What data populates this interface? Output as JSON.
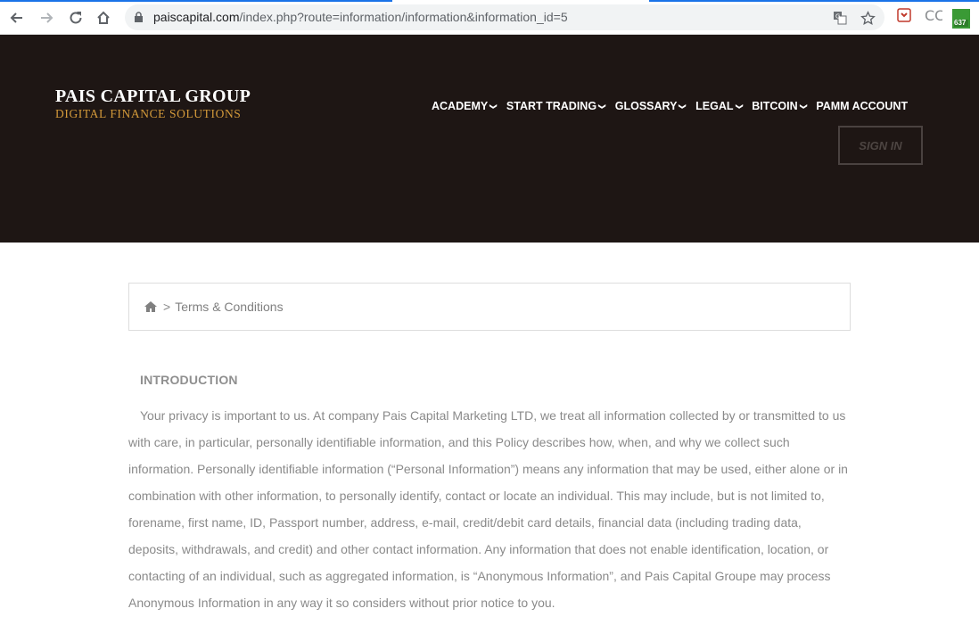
{
  "browser": {
    "url_host": "paiscapital.com",
    "url_path": "/index.php?route=information/information&information_id=5",
    "extension_badge": "637"
  },
  "site": {
    "logo_line1": "PAIS CAPITAL GROUP",
    "logo_line2": "DIGITAL FINANCE SOLUTIONS",
    "menu": [
      {
        "label": "ACADEMY",
        "has_dropdown": true
      },
      {
        "label": "START TRADING",
        "has_dropdown": true
      },
      {
        "label": "GLOSSARY",
        "has_dropdown": true
      },
      {
        "label": "LEGAL",
        "has_dropdown": true
      },
      {
        "label": "BITCOIN",
        "has_dropdown": true
      },
      {
        "label": "PAMM ACCOUNT",
        "has_dropdown": false
      }
    ],
    "signin_label": "SIGN IN"
  },
  "breadcrumb": {
    "separator": ">",
    "current": "Terms & Conditions"
  },
  "content": {
    "heading": "INTRODUCTION",
    "paragraph": "Your privacy is important to us. At company Pais Capital Marketing LTD, we treat all information collected by or transmitted to us with care, in particular, personally identifiable information, and this Policy describes how, when, and why we collect such information. Personally identifiable information (“Personal Information”) means any information that may be used, either alone or in combination with other information, to personally identify, contact or locate an individual. This may include, but is not limited to, forename, first name, ID, Passport number, address, e-mail, credit/debit card details, financial data (including trading data, deposits, withdrawals, and credit) and other contact information. Any information that does not enable identification, location, or contacting of an individual, such as aggregated information, is “Anonymous Information”, and Pais Capital Groupe may process Anonymous Information in any way it so considers without prior notice to you."
  },
  "colors": {
    "header_bg": "#1e1614",
    "logo_accent": "#d49a3a",
    "body_text": "#8a8a8a"
  }
}
